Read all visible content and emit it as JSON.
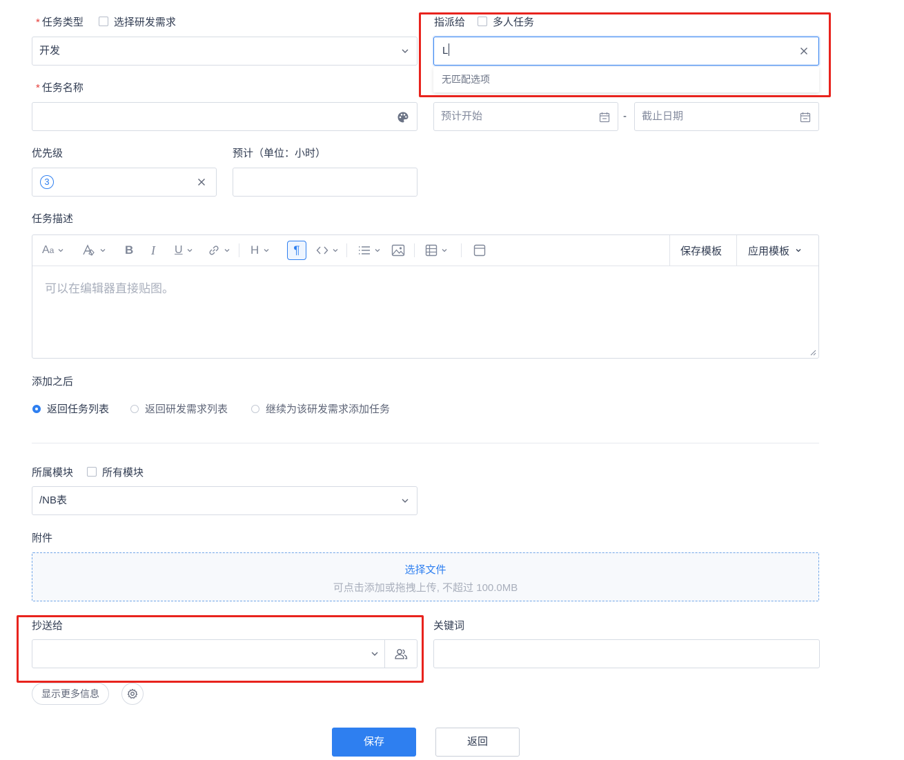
{
  "task_type": {
    "required_mark": "*",
    "label": "任务类型",
    "checkbox_label": "选择研发需求",
    "value": "开发"
  },
  "assign_to": {
    "label": "指派给",
    "checkbox_label": "多人任务",
    "input_value": "L",
    "dropdown_message": "无匹配选项"
  },
  "task_name": {
    "required_mark": "*",
    "label": "任务名称",
    "value": ""
  },
  "dates": {
    "start_placeholder": "预计开始",
    "separator": "-",
    "end_placeholder": "截止日期"
  },
  "priority": {
    "label": "优先级",
    "value": "3"
  },
  "estimate": {
    "label": "预计（单位：小时）",
    "value": ""
  },
  "description": {
    "label": "任务描述",
    "placeholder": "可以在编辑器直接贴图。",
    "save_template_label": "保存模板",
    "apply_template_label": "应用模板"
  },
  "after_add": {
    "label": "添加之后",
    "options": [
      {
        "label": "返回任务列表",
        "selected": true
      },
      {
        "label": "返回研发需求列表",
        "selected": false
      },
      {
        "label": "继续为该研发需求添加任务",
        "selected": false
      }
    ]
  },
  "module": {
    "label": "所属模块",
    "checkbox_label": "所有模块",
    "value": "/NB表"
  },
  "attachment": {
    "label": "附件",
    "choose_label": "选择文件",
    "hint": "可点击添加或拖拽上传, 不超过 100.0MB"
  },
  "cc": {
    "label": "抄送给",
    "value": ""
  },
  "keywords": {
    "label": "关键词",
    "value": ""
  },
  "more_info_label": "显示更多信息",
  "actions": {
    "save_label": "保存",
    "back_label": "返回"
  },
  "colors": {
    "primary": "#2e7ff0",
    "highlight": "#e8231d",
    "required": "#e6403c"
  }
}
